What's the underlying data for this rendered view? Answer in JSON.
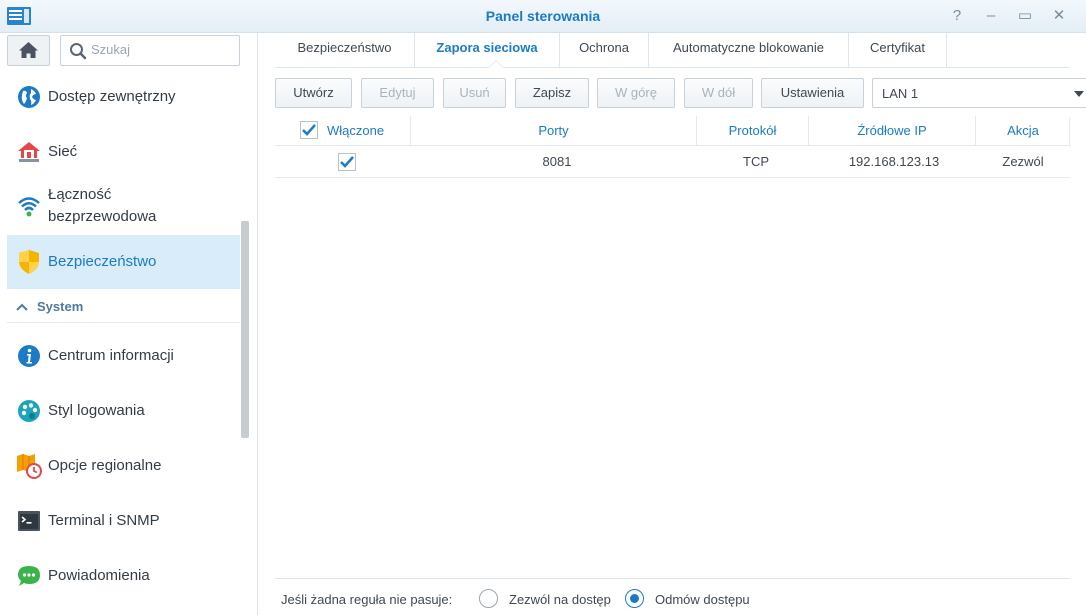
{
  "window": {
    "title": "Panel sterowania",
    "help_icon": "?",
    "minimize_icon": "–",
    "maximize_icon": "▭",
    "close_icon": "✕"
  },
  "sidebar": {
    "search_placeholder": "Szukaj",
    "items": [
      {
        "label": "Dostęp zewnętrzny",
        "icon": "globe-icon"
      },
      {
        "label": "Sieć",
        "icon": "house-network-icon"
      },
      {
        "label": "Łączność\nbezprzewodowa",
        "icon": "wifi-icon"
      },
      {
        "label": "Bezpieczeństwo",
        "icon": "shield-icon",
        "active": true
      }
    ],
    "section": {
      "label": "System"
    },
    "system_items": [
      {
        "label": "Centrum informacji",
        "icon": "info-icon"
      },
      {
        "label": "Styl logowania",
        "icon": "palette-icon"
      },
      {
        "label": "Opcje regionalne",
        "icon": "map-clock-icon"
      },
      {
        "label": "Terminal i SNMP",
        "icon": "terminal-icon"
      },
      {
        "label": "Powiadomienia",
        "icon": "chat-bubble-icon"
      }
    ]
  },
  "tabs": [
    {
      "label": "Bezpieczeństwo"
    },
    {
      "label": "Zapora sieciowa",
      "active": true
    },
    {
      "label": "Ochrona"
    },
    {
      "label": "Automatyczne blokowanie"
    },
    {
      "label": "Certyfikat"
    }
  ],
  "toolbar": {
    "create": "Utwórz",
    "edit": "Edytuj",
    "delete": "Usuń",
    "save": "Zapisz",
    "up": "W górę",
    "down": "W dół",
    "settings": "Ustawienia",
    "interface_value": "LAN 1"
  },
  "table": {
    "columns": [
      "Włączone",
      "Porty",
      "Protokół",
      "Źródłowe IP",
      "Akcja"
    ],
    "rows": [
      {
        "enabled": true,
        "ports": "8081",
        "protocol": "TCP",
        "source_ip": "192.168.123.13",
        "action": "Zezwól"
      }
    ]
  },
  "footer": {
    "label": "Jeśli żadna reguła nie pasuje:",
    "option_allow": "Zezwól na dostęp",
    "option_deny": "Odmów dostępu",
    "selected": "deny"
  },
  "colors": {
    "accent": "#1c7bc4",
    "active_bg": "#d9ecfa"
  }
}
